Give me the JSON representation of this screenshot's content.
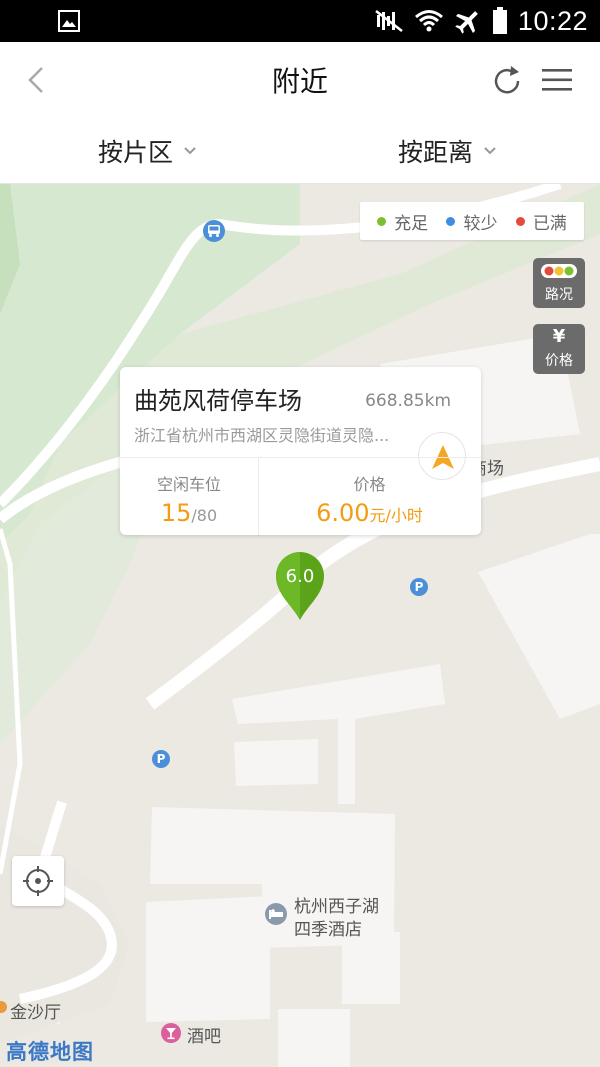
{
  "status_bar": {
    "time": "10:22"
  },
  "header": {
    "title": "附近"
  },
  "filters": {
    "area_label": "按片区",
    "distance_label": "按距离"
  },
  "legend": [
    {
      "label": "充足",
      "color": "#7cc031"
    },
    {
      "label": "较少",
      "color": "#3d8de0"
    },
    {
      "label": "已满",
      "color": "#e24a3b"
    }
  ],
  "map_buttons": {
    "traffic_label": "路况",
    "price_symbol": "¥",
    "price_label": "价格"
  },
  "popup": {
    "name": "曲苑风荷停车场",
    "distance": "668.85km",
    "address": "浙江省杭州市西湖区灵隐街道灵隐...",
    "free_label": "空闲车位",
    "free_count": "15",
    "total_separator": "/80",
    "price_label": "价格",
    "price_value": "6.00",
    "price_unit": "元/小时"
  },
  "pin_value": "6.0",
  "map_labels": {
    "mall": "商场",
    "hotel_line1": "杭州西子湖",
    "hotel_line2": "四季酒店",
    "golden_hall": "金沙厅",
    "bar": "酒吧",
    "parking_symbol": "P"
  },
  "map_brand": "高德地图"
}
